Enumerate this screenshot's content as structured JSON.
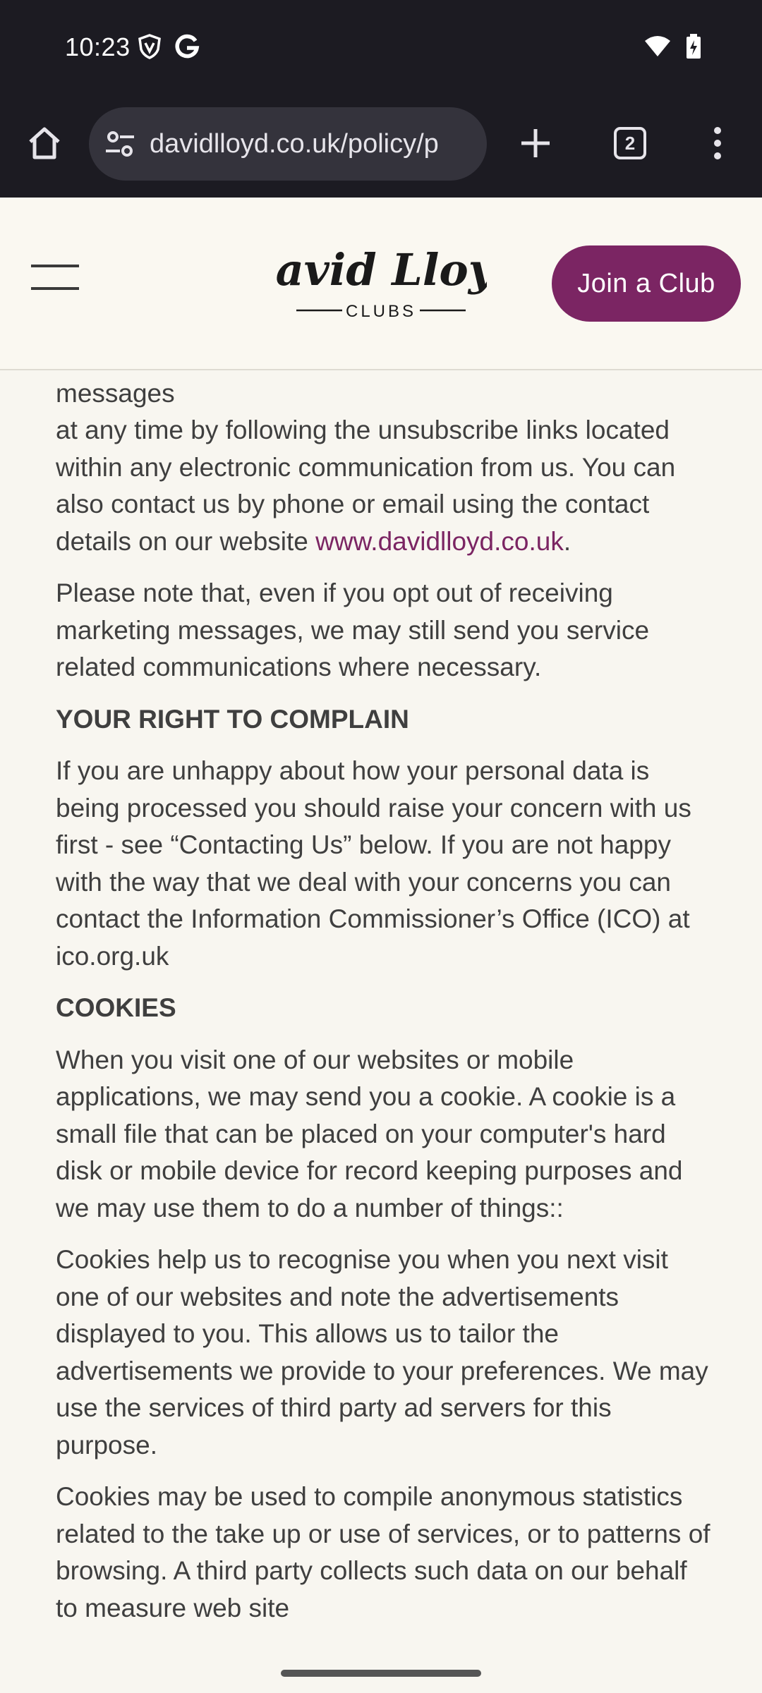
{
  "status_bar": {
    "time": "10:23",
    "icons_left": [
      "vpn-shield-icon",
      "google-g-icon"
    ],
    "icons_right": [
      "wifi-icon",
      "battery-charging-icon"
    ]
  },
  "browser": {
    "url": "davidlloyd.co.uk/policy/p",
    "tab_count": "2",
    "buttons": [
      "home-icon",
      "new-tab-icon",
      "tabs-switcher",
      "overflow-menu-icon"
    ]
  },
  "header": {
    "logo_script": "David Lloyd",
    "logo_sub": "CLUBS",
    "join_button": "Join a Club"
  },
  "content": {
    "p_opt_out_cut": "communications or opt out of receiving marketing messages",
    "p_opt_out_pre": "at any time by following the unsubscribe links located within any electronic communication from us. You can also contact us by phone or email using the contact details on our website",
    "p_opt_out_link": "www.davidlloyd.co.uk",
    "p_opt_out_post": ".",
    "p_note": "Please note that, even if you opt out of receiving marketing messages, we may still send you service related communications where necessary.",
    "h_complain": "YOUR RIGHT TO COMPLAIN",
    "p_complain": "If you are unhappy about how your personal data is being processed you should raise your concern with us first - see “Contacting Us” below. If you are not happy with the way that we deal with your concerns you can contact the Information Commissioner’s Office (ICO) at ico.org.uk",
    "h_cookies": "COOKIES",
    "p_cookies_1": "When you visit one of our websites or mobile applications, we may send you a cookie. A cookie is a small file that can be placed on your computer's hard disk or mobile device for record keeping purposes and we may use them to do a number of things::",
    "p_cookies_2": "Cookies help us to recognise you when you next visit one of our websites and note the advertisements displayed to you. This allows us to tailor the advertisements we provide to your preferences. We may use the services of third party ad servers for this purpose.",
    "p_cookies_3": "Cookies may be used to compile anonymous statistics related to the take up or use of services, or to patterns of browsing. A third party collects such data on our behalf to measure web site"
  },
  "colors": {
    "brand": "#7b2563",
    "chrome_bg": "#1c1b22",
    "page_bg": "#f8f6f0",
    "text": "#3f3f3f"
  }
}
